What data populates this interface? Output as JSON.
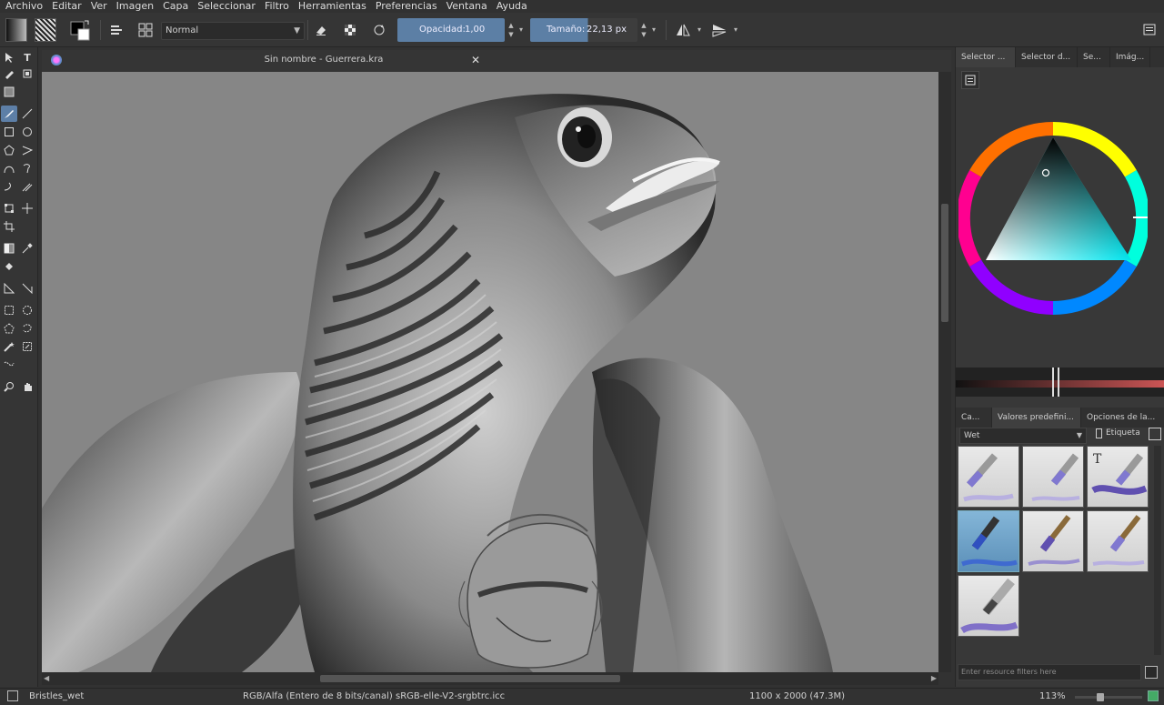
{
  "menu": [
    "Archivo",
    "Editar",
    "Ver",
    "Imagen",
    "Capa",
    "Seleccionar",
    "Filtro",
    "Herramientas",
    "Preferencias",
    "Ventana",
    "Ayuda"
  ],
  "toolbar": {
    "blend_mode": "Normal",
    "opacity_label": "Opacidad:",
    "opacity_value": "1,00",
    "size_label": "Tamaño:",
    "size_value": "22,13 px"
  },
  "document": {
    "title": "Sin nombre - Guerrera.kra"
  },
  "dock": {
    "top_tabs": [
      "Selector ...",
      "Selector d...",
      "Se...",
      "Imág..."
    ],
    "bottom_tabs": [
      "Ca...",
      "Valores predefini...",
      "Opciones de la..."
    ],
    "preset_filter": "Wet",
    "tag_label": "Etiqueta",
    "resource_filter_placeholder": "Enter resource filters here"
  },
  "colors": {
    "accent": "#5c7fa5",
    "canvas_bg": "#868686",
    "panel_bg": "#383838"
  },
  "status": {
    "preset": "Bristles_wet",
    "color_space": "RGB/Alfa (Entero de 8 bits/canal)  sRGB-elle-V2-srgbtrc.icc",
    "dimensions": "1100 x 2000 (47.3M)",
    "zoom": "113%"
  }
}
